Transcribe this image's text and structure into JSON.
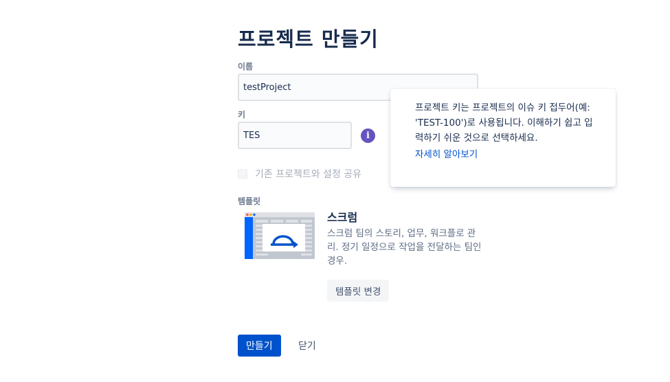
{
  "page": {
    "title": "프로젝트 만들기"
  },
  "form": {
    "name_label": "이름",
    "name_value": "testProject",
    "key_label": "키",
    "key_value": "TES",
    "share_label": "기존 프로젝트와 설정 공유"
  },
  "template": {
    "label": "템플릿",
    "name": "스크럼",
    "description": "스크럼 팀의 스토리, 업무, 워크플로 관리. 정기 일정으로 작업을 전달하는 팀인 경우.",
    "change_button": "템플릿 변경"
  },
  "actions": {
    "create": "만들기",
    "close": "닫기"
  },
  "popup": {
    "text": "프로젝트 키는 프로젝트의 이슈 키 접두어(예: 'TEST-100')로 사용됩니다. 이해하기 쉽고 입력하기 쉬운 것으로 선택하세요.",
    "link": "자세히 알아보기"
  },
  "colors": {
    "primary": "#0052cc",
    "info_icon": "#6554c0",
    "text": "#172b4d"
  },
  "icons": {
    "info": "info-icon",
    "template_preview": "scrum-board-icon"
  }
}
